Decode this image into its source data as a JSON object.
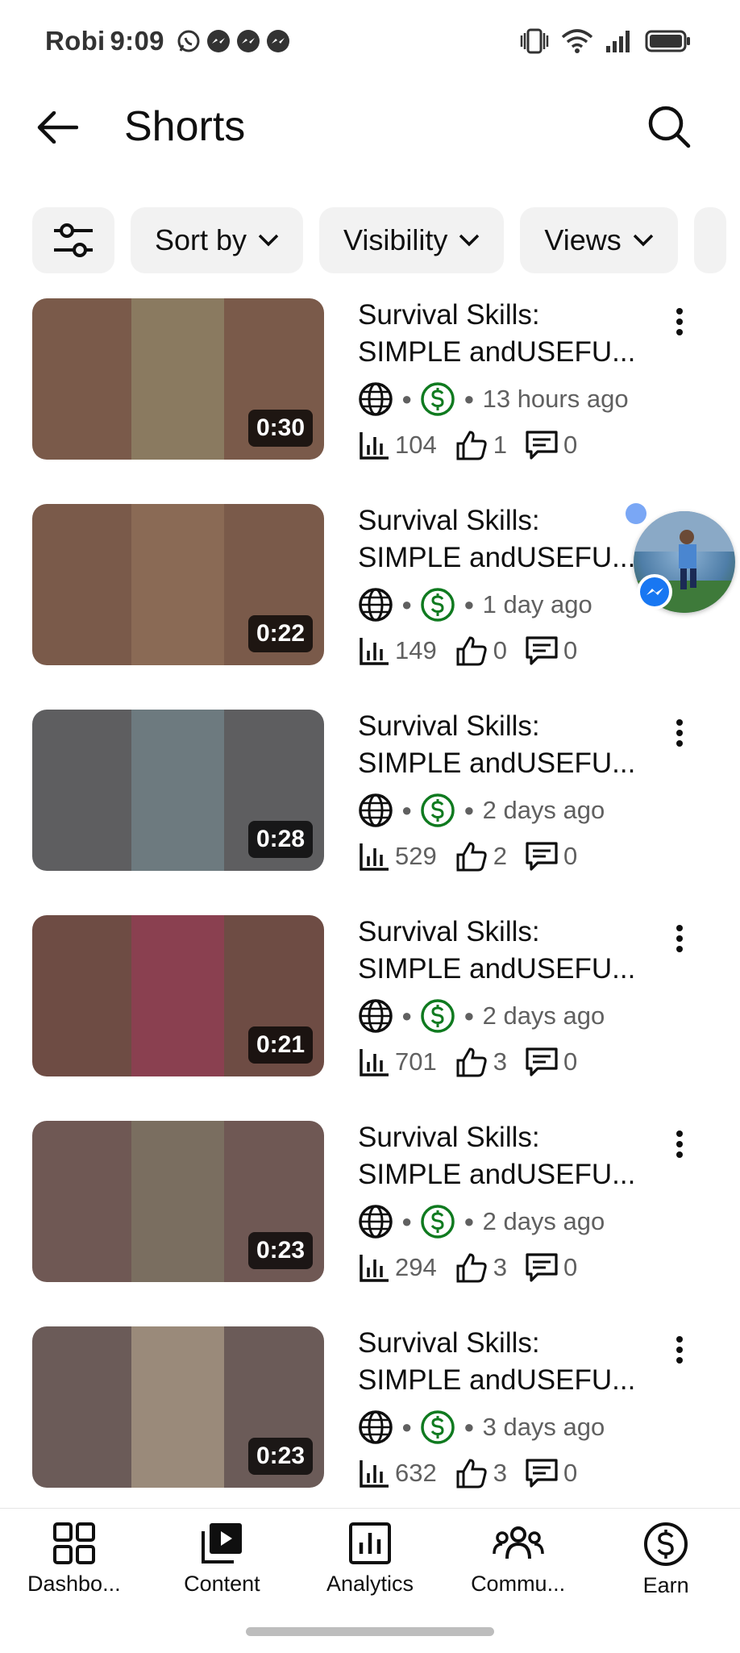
{
  "status_bar": {
    "carrier": "Robi",
    "time": "9:09",
    "app_icons": [
      "whatsapp-icon",
      "messenger-icon",
      "messenger-icon",
      "messenger-icon"
    ],
    "system_icons": [
      "vibrate-icon",
      "wifi-icon",
      "signal-icon",
      "battery-icon"
    ]
  },
  "header": {
    "title": "Shorts",
    "back_icon": "arrow-left-icon",
    "search_icon": "search-icon"
  },
  "filters": {
    "settings_icon": "sliders-icon",
    "chips": [
      {
        "label": "Sort by"
      },
      {
        "label": "Visibility"
      },
      {
        "label": "Views"
      }
    ]
  },
  "videos": [
    {
      "title_line1": "Survival Skills:",
      "title_line2": "SIMPLE andUSEFU...",
      "duration": "0:30",
      "age": "13 hours ago",
      "views": "104",
      "likes": "1",
      "comments": "0",
      "thumb_bg": "#7a5a4a",
      "thumb_center": "#8a7a60"
    },
    {
      "title_line1": "Survival Skills:",
      "title_line2": "SIMPLE andUSEFU...",
      "duration": "0:22",
      "age": "1 day ago",
      "views": "149",
      "likes": "0",
      "comments": "0",
      "thumb_bg": "#7a5a4a",
      "thumb_center": "#8a6a55"
    },
    {
      "title_line1": "Survival Skills:",
      "title_line2": "SIMPLE andUSEFU...",
      "duration": "0:28",
      "age": "2 days ago",
      "views": "529",
      "likes": "2",
      "comments": "0",
      "thumb_bg": "#5e5e60",
      "thumb_center": "#6d7a7f"
    },
    {
      "title_line1": "Survival Skills:",
      "title_line2": "SIMPLE andUSEFU...",
      "duration": "0:21",
      "age": "2 days ago",
      "views": "701",
      "likes": "3",
      "comments": "0",
      "thumb_bg": "#6e4c44",
      "thumb_center": "#8a4050"
    },
    {
      "title_line1": "Survival Skills:",
      "title_line2": "SIMPLE andUSEFU...",
      "duration": "0:23",
      "age": "2 days ago",
      "views": "294",
      "likes": "3",
      "comments": "0",
      "thumb_bg": "#6f5854",
      "thumb_center": "#7a6e60"
    },
    {
      "title_line1": "Survival Skills:",
      "title_line2": "SIMPLE andUSEFU...",
      "duration": "0:23",
      "age": "3 days ago",
      "views": "632",
      "likes": "3",
      "comments": "0",
      "thumb_bg": "#6b5b58",
      "thumb_center": "#9a8a7a"
    }
  ],
  "colors": {
    "monetization_green": "#0f7a1f",
    "chip_bg": "#f2f2f2",
    "meta_gray": "#606060"
  },
  "bottom_nav": [
    {
      "label": "Dashbo...",
      "icon": "dashboard-icon"
    },
    {
      "label": "Content",
      "icon": "content-icon"
    },
    {
      "label": "Analytics",
      "icon": "analytics-icon"
    },
    {
      "label": "Commu...",
      "icon": "community-icon"
    },
    {
      "label": "Earn",
      "icon": "earn-icon"
    }
  ]
}
